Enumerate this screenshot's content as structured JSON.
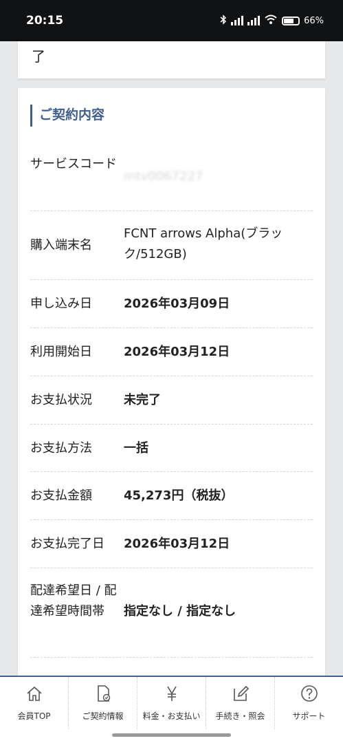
{
  "status_bar": {
    "time": "20:15",
    "battery_percent": "66%",
    "icons": [
      "bluetooth-icon",
      "signal-icon",
      "signal-icon",
      "wifi-icon",
      "battery-icon"
    ]
  },
  "previous_card": {
    "text": "了"
  },
  "contract": {
    "title": "ご契約内容",
    "rows": [
      {
        "label": "サービスコード",
        "value": "mtv0067227"
      },
      {
        "label": "購入端末名",
        "value": "FCNT arrows Alpha(ブラック/512GB)"
      },
      {
        "label": "申し込み日",
        "value": "2026年03月09日"
      },
      {
        "label": "利用開始日",
        "value": "2026年03月12日"
      },
      {
        "label": "お支払状況",
        "value": "未完了"
      },
      {
        "label": "お支払方法",
        "value": "一括"
      },
      {
        "label": "お支払金額",
        "value": "45,273円（税抜）"
      },
      {
        "label": "お支払完了日",
        "value": "2026年03月12日"
      },
      {
        "label": "配達希望日 / 配達希望時間帯",
        "value": "指定なし / 指定なし"
      }
    ]
  },
  "tabbar": {
    "items": [
      {
        "label": "会員TOP",
        "icon": "home-icon"
      },
      {
        "label": "ご契約情報",
        "icon": "contract-document-icon"
      },
      {
        "label": "料金・お支払い",
        "icon": "yen-icon"
      },
      {
        "label": "手続き・照会",
        "icon": "edit-icon"
      },
      {
        "label": "サポート",
        "icon": "help-icon"
      }
    ]
  }
}
